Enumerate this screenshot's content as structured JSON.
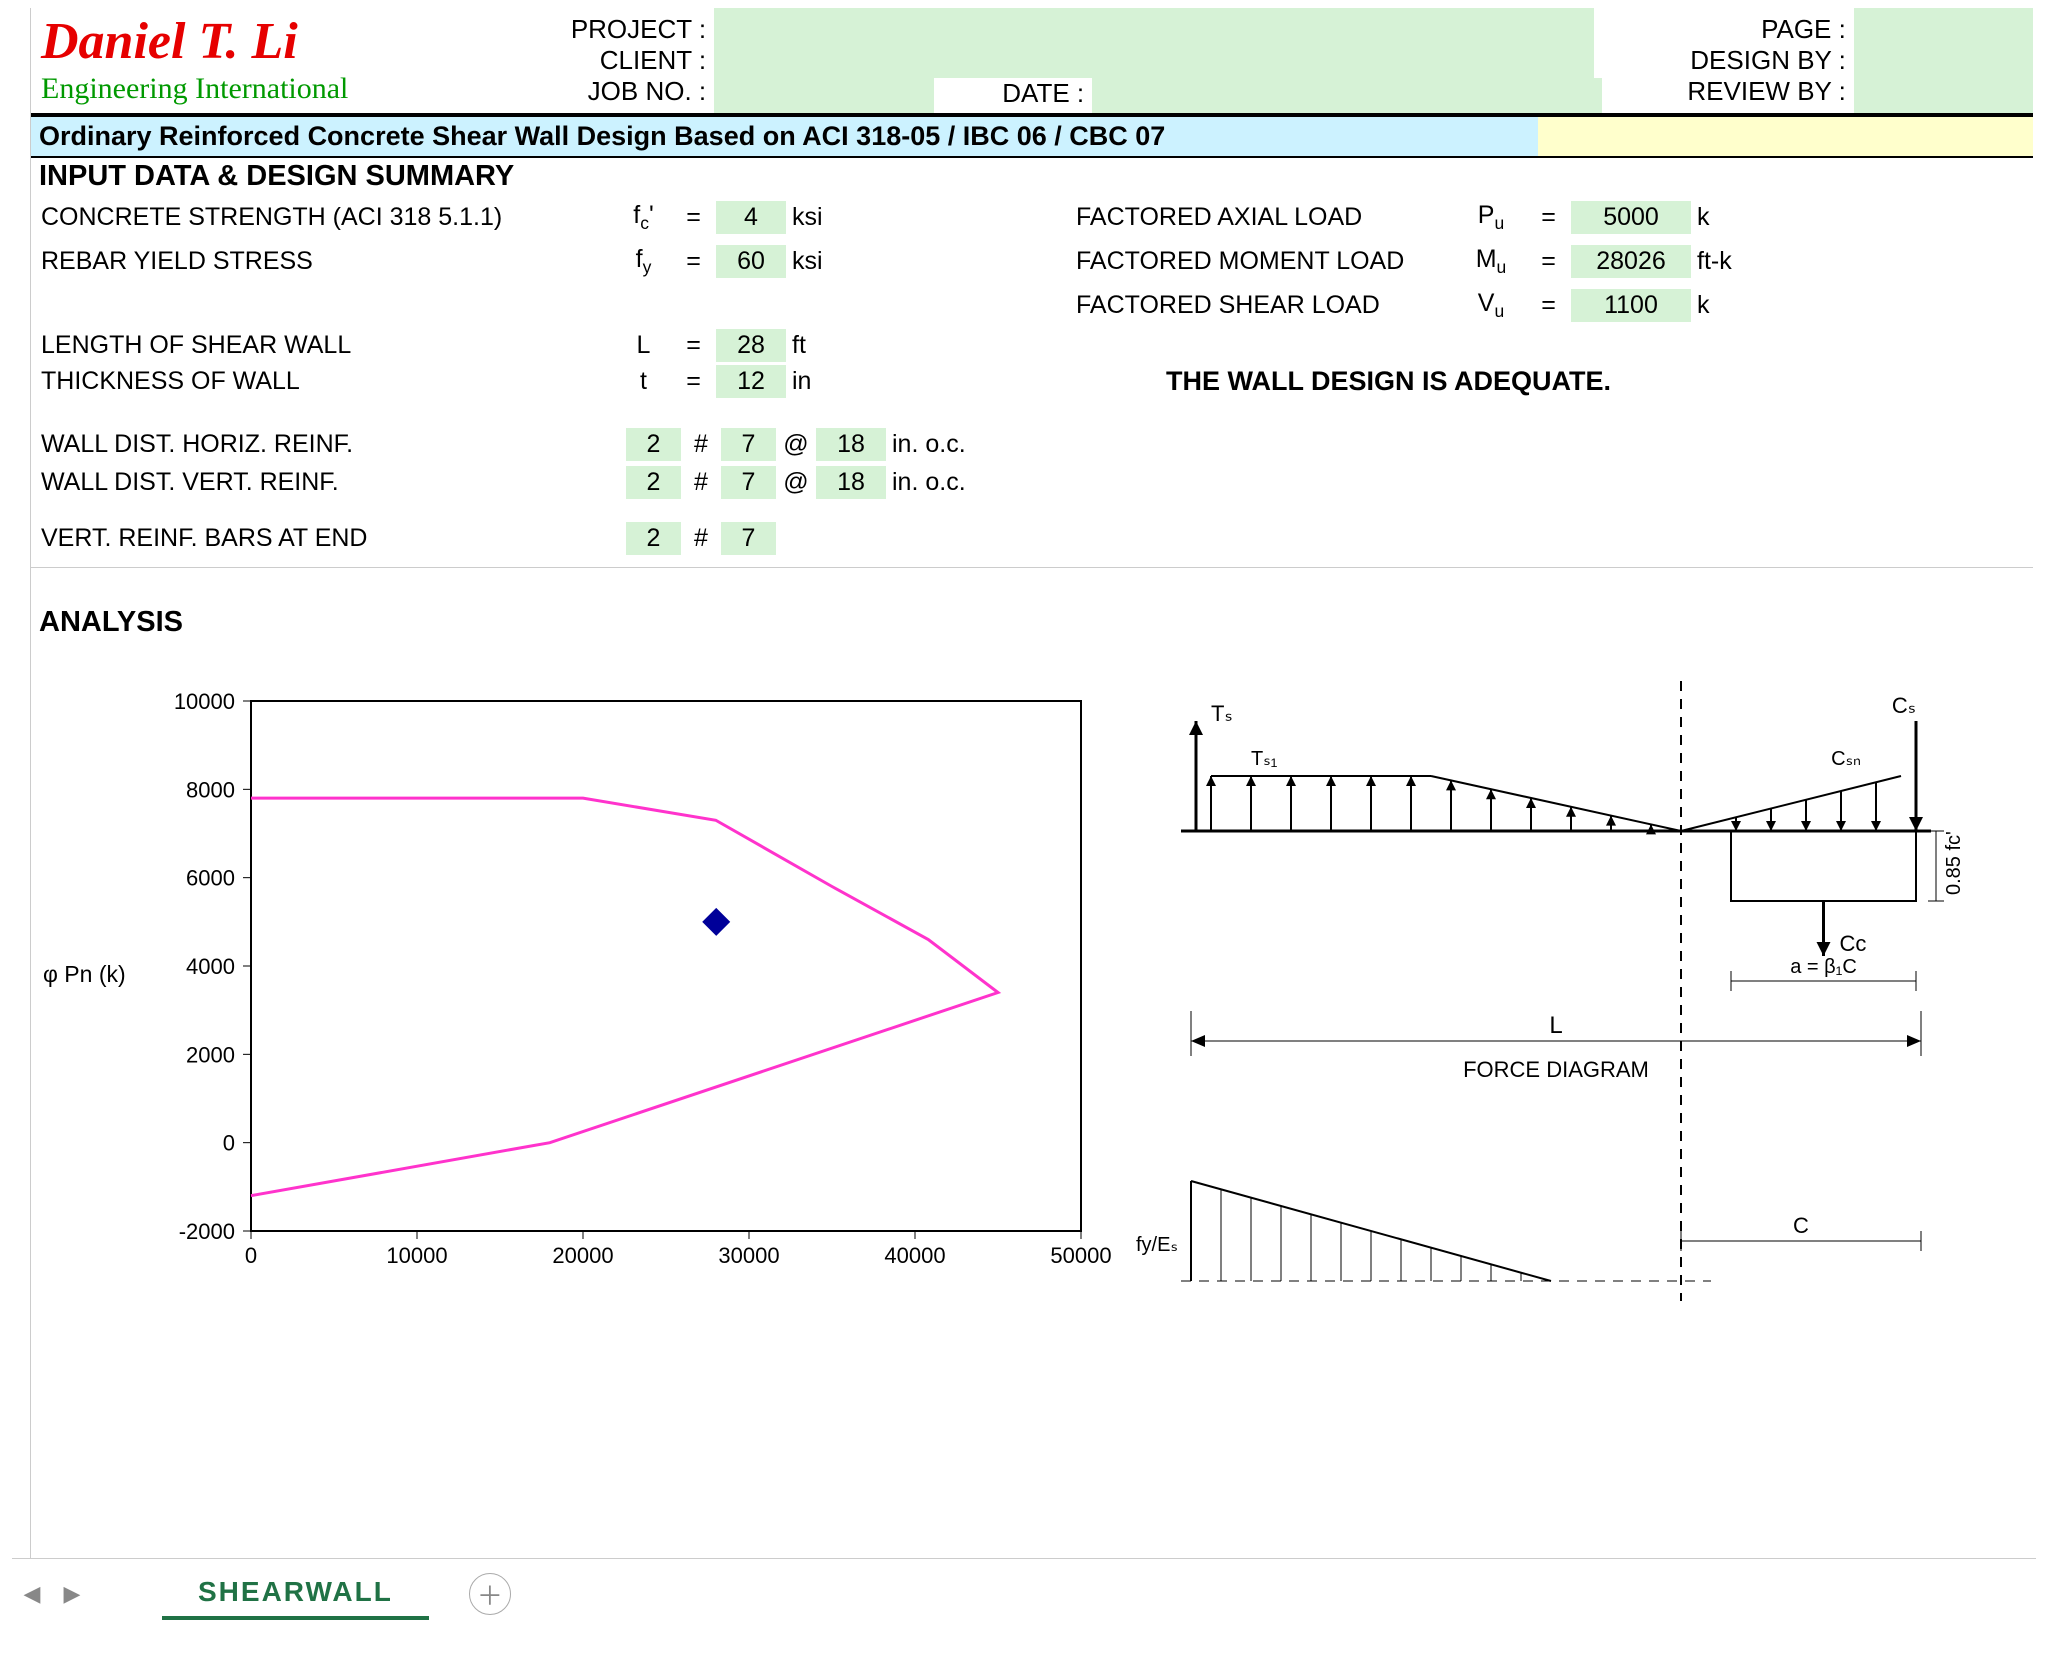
{
  "logo": {
    "name": "Daniel T. Li",
    "subtitle": "Engineering International"
  },
  "hdr": {
    "project": "PROJECT :",
    "client": "CLIENT :",
    "jobno": "JOB NO. :",
    "date": "DATE :",
    "page": "PAGE :",
    "designby": "DESIGN BY :",
    "reviewby": "REVIEW BY :"
  },
  "title": "Ordinary Reinforced Concrete Shear Wall Design Based on ACI 318-05 / IBC 06 / CBC 07",
  "sections": {
    "input": "INPUT DATA & DESIGN SUMMARY",
    "analysis": "ANALYSIS"
  },
  "inputs": {
    "fc_label": "CONCRETE STRENGTH (ACI 318 5.1.1)",
    "fc_sym": "f",
    "fc_sub": "c",
    "fc_sup": "'",
    "fc_val": "4",
    "fc_unit": "ksi",
    "fy_label": "REBAR YIELD STRESS",
    "fy_sym": "f",
    "fy_sub": "y",
    "fy_val": "60",
    "fy_unit": "ksi",
    "L_label": "LENGTH OF SHEAR WALL",
    "L_sym": "L",
    "L_val": "28",
    "L_unit": "ft",
    "t_label": "THICKNESS OF  WALL",
    "t_sym": "t",
    "t_val": "12",
    "t_unit": "in",
    "hreinf_label": "WALL DIST. HORIZ. REINF.",
    "vreinf_label": "WALL DIST. VERT. REINF.",
    "endreinf_label": "VERT. REINF. BARS AT END",
    "reinf_n": "2",
    "reinf_bar": "7",
    "reinf_spc": "18",
    "oc": "in. o.c.",
    "hash": "#",
    "at": "@"
  },
  "loads": {
    "pu_label": "FACTORED AXIAL LOAD",
    "pu_sym": "P",
    "pu_sub": "u",
    "pu_val": "5000",
    "pu_unit": "k",
    "mu_label": "FACTORED MOMENT LOAD",
    "mu_sym": "M",
    "mu_sub": "u",
    "mu_val": "28026",
    "mu_unit": "ft-k",
    "vu_label": "FACTORED SHEAR LOAD",
    "vu_sym": "V",
    "vu_sub": "u",
    "vu_val": "1100",
    "vu_unit": "k",
    "adequate": "THE WALL DESIGN IS ADEQUATE."
  },
  "eq": "=",
  "chart_data": {
    "type": "line",
    "xlabel": "",
    "ylabel": "φ Pn (k)",
    "x_ticks": [
      0,
      10000,
      20000,
      30000,
      40000,
      50000
    ],
    "y_ticks": [
      -2000,
      0,
      2000,
      4000,
      6000,
      8000,
      10000
    ],
    "xlim": [
      0,
      50000
    ],
    "ylim": [
      -2000,
      10000
    ],
    "series": [
      {
        "name": "interaction-curve",
        "color": "#ff33cc",
        "x": [
          0,
          0,
          20000,
          28000,
          35000,
          40800,
          45000,
          18000,
          0
        ],
        "y": [
          7800,
          7800,
          7800,
          7300,
          5800,
          4600,
          3400,
          0,
          -1200
        ]
      }
    ],
    "marker": {
      "x": 28026,
      "y": 5000,
      "color": "#000099"
    }
  },
  "diagram": {
    "Ts": "Tₛ",
    "Ts1": "Tₛ₁",
    "Cs": "Cₛ",
    "Csn": "Cₛₙ",
    "Cc": "Cc",
    "L": "L",
    "title": "FORCE  DIAGRAM",
    "block085": "0.85 fc'",
    "a_eq": "a  =  β₁C",
    "fy_over_Es": "fy/Eₛ",
    "C": "C"
  },
  "tab": "SHEARWALL"
}
